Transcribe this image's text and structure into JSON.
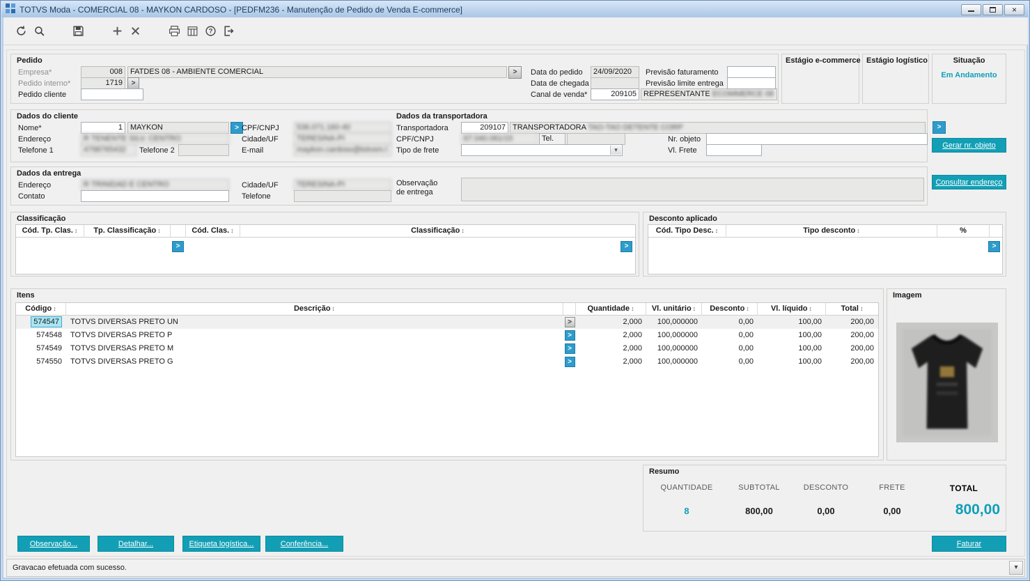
{
  "window": {
    "title": "TOTVS Moda - COMERCIAL 08 - MAYKON CARDOSO - [PEDFM236 - Manutenção de Pedido de Venda E-commerce]"
  },
  "icons": {
    "sort": "↕",
    "arrow": ">",
    "dropdown": "▾",
    "close": "×"
  },
  "toolbar": {
    "icon_names": [
      "undo",
      "search",
      "save",
      "new",
      "delete",
      "print",
      "schedule",
      "help",
      "exit"
    ]
  },
  "colors": {
    "accent": "#0f9fb8",
    "selection": "#a9e6f4",
    "button_teal": "#129fb5"
  },
  "pedido": {
    "title": "Pedido",
    "labels": {
      "empresa": "Empresa*",
      "pedido_interno": "Pedido interno*",
      "pedido_cliente": "Pedido cliente",
      "data_pedido": "Data do pedido",
      "data_chegada": "Data de chegada",
      "canal_venda": "Canal de venda*",
      "previsao_faturamento": "Previsão faturamento",
      "previsao_limite": "Previsão limite entrega"
    },
    "empresa_codigo": "008",
    "empresa_descricao": "FATDES 08 - AMBIENTE COMERCIAL",
    "pedido_interno": "1719",
    "pedido_cliente": "",
    "data_pedido": "24/09/2020",
    "data_chegada": "",
    "canal_venda_codigo": "209105",
    "canal_venda_descricao": "REPRESENTANTE",
    "canal_venda_descricao_redacted": "ECOMMERCE 08",
    "previsao_faturamento": "",
    "previsao_limite": ""
  },
  "estagio_ecommerce": {
    "title": "Estágio e-commerce"
  },
  "estagio_logistico": {
    "title": "Estágio logístico"
  },
  "situacao": {
    "title": "Situação",
    "value": "Em Andamento"
  },
  "cliente": {
    "title": "Dados do cliente",
    "labels": {
      "nome": "Nome*",
      "endereco": "Endereço",
      "telefone1": "Telefone 1",
      "telefone2": "Telefone 2",
      "cpf_cnpj": "CPF/CNPJ",
      "cidade_uf": "Cidade/UF",
      "email": "E-mail"
    },
    "nome_codigo": "1",
    "nome": "MAYKON",
    "cpf_cnpj": "536.071.160-40",
    "endereco": "R TENENTE SILV. CENTRO",
    "cidade_uf": "TERESINA-PI",
    "telefone1": "4798765432",
    "telefone2": "",
    "email": "maykon.cardoso@totvsm.l"
  },
  "transportadora": {
    "title": "Dados da transportadora",
    "labels": {
      "transportadora": "Transportadora",
      "cpf_cnpj": "CPF/CNPJ",
      "tel": "Tel.",
      "tipo_frete": "Tipo de frete",
      "nr_objeto": "Nr. objeto",
      "vl_frete": "Vl. Frete"
    },
    "codigo": "209107",
    "nome_visivel": "TRANSPORTADORA",
    "nome_redacted": "TAO-TAO DETENTE CORP",
    "cpf_cnpj": "67.040.061/15",
    "tel": "",
    "tipo_frete": "",
    "nr_objeto": "",
    "vl_frete": ""
  },
  "entrega": {
    "title": "Dados da entrega",
    "labels": {
      "endereco": "Endereço",
      "contato": "Contato",
      "cidade_uf": "Cidade/UF",
      "telefone": "Telefone",
      "observacao_l1": "Observação",
      "observacao_l2": "de entrega"
    },
    "endereco": "R TRINIDAD E CENTRO",
    "cidade_uf": "TERESINA-PI",
    "contato": "",
    "telefone": "",
    "observacao": ""
  },
  "classificacao": {
    "title": "Classificação",
    "headers": [
      "Cód. Tp. Clas.",
      "Tp. Classificação",
      "Cód. Clas.",
      "Classificação"
    ]
  },
  "desconto_aplicado": {
    "title": "Desconto aplicado",
    "headers": [
      "Cód. Tipo Desc.",
      "Tipo desconto",
      "%"
    ]
  },
  "itens": {
    "title": "Itens",
    "headers": [
      "Código",
      "Descrição",
      "Quantidade",
      "Vl. unitário",
      "Desconto",
      "Vl. líquido",
      "Total"
    ],
    "rows": [
      {
        "codigo": "574547",
        "descricao": "TOTVS DIVERSAS PRETO UN",
        "quantidade": "2,000",
        "vl_unitario": "100,000000",
        "desconto": "0,00",
        "vl_liquido": "100,00",
        "total": "200,00"
      },
      {
        "codigo": "574548",
        "descricao": "TOTVS DIVERSAS PRETO P",
        "quantidade": "2,000",
        "vl_unitario": "100,000000",
        "desconto": "0,00",
        "vl_liquido": "100,00",
        "total": "200,00"
      },
      {
        "codigo": "574549",
        "descricao": "TOTVS DIVERSAS PRETO M",
        "quantidade": "2,000",
        "vl_unitario": "100,000000",
        "desconto": "0,00",
        "vl_liquido": "100,00",
        "total": "200,00"
      },
      {
        "codigo": "574550",
        "descricao": "TOTVS DIVERSAS PRETO G",
        "quantidade": "2,000",
        "vl_unitario": "100,000000",
        "desconto": "0,00",
        "vl_liquido": "100,00",
        "total": "200,00"
      }
    ]
  },
  "imagem": {
    "title": "Imagem"
  },
  "resumo": {
    "title": "Resumo",
    "labels": [
      "QUANTIDADE",
      "SUBTOTAL",
      "DESCONTO",
      "FRETE",
      "TOTAL"
    ],
    "quantidade": "8",
    "subtotal": "800,00",
    "desconto": "0,00",
    "frete": "0,00",
    "total": "800,00"
  },
  "buttons": {
    "observacao": "Observação...",
    "detalhar": "Detalhar...",
    "etiqueta": "Etiqueta logística...",
    "conferencia": "Conferência...",
    "faturar": "Faturar",
    "gerar_objeto": "Gerar nr. objeto",
    "consultar_endereco": "Consultar endereço"
  },
  "statusbar": {
    "message": "Gravacao efetuada com sucesso."
  }
}
